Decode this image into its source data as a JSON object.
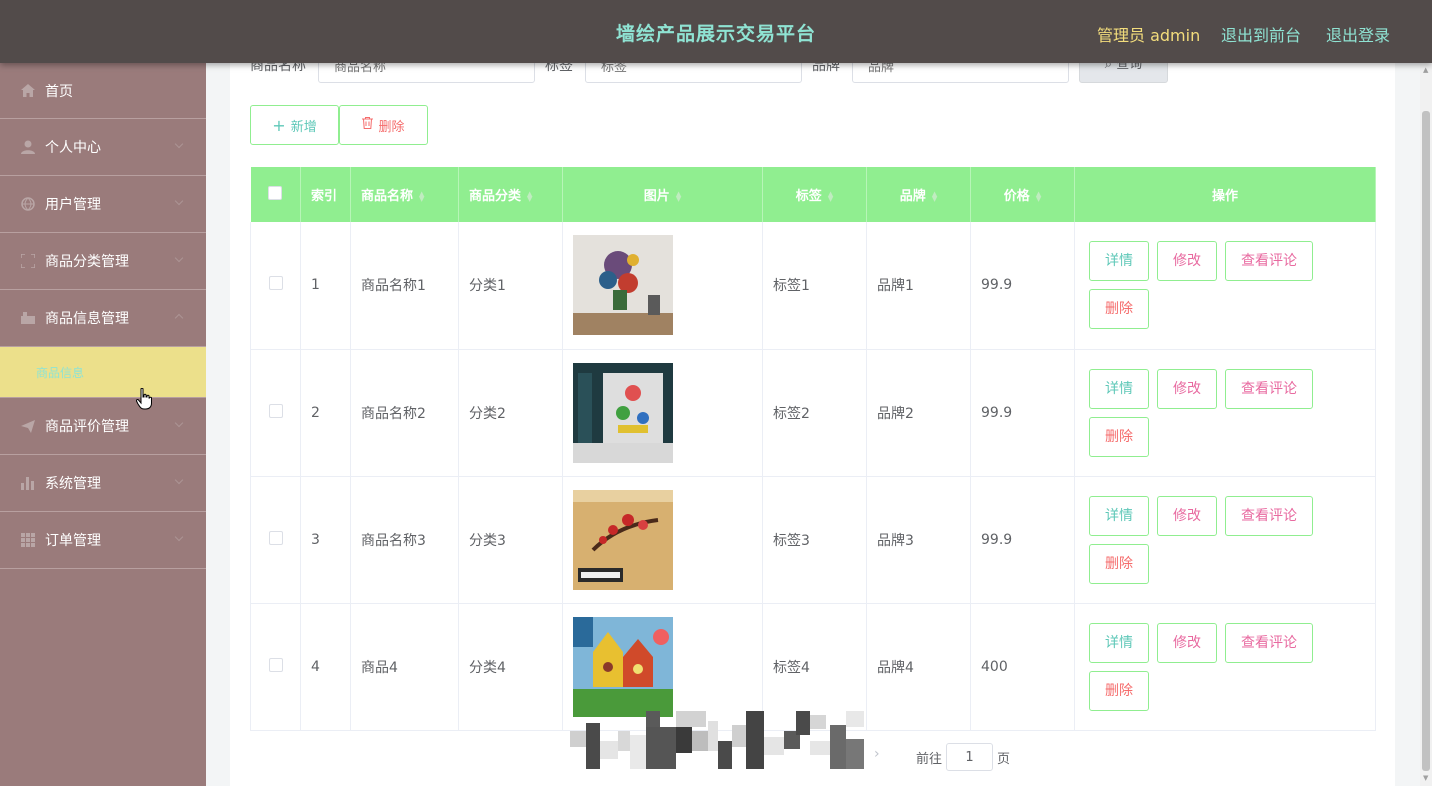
{
  "header": {
    "title": "墙绘产品展示交易平台",
    "admin_label": "管理员 admin",
    "front_link": "退出到前台",
    "logout_link": "退出登录"
  },
  "sidebar": {
    "items": [
      {
        "label": "首页",
        "icon": "home-icon"
      },
      {
        "label": "个人中心",
        "icon": "user-icon"
      },
      {
        "label": "用户管理",
        "icon": "globe-icon"
      },
      {
        "label": "商品分类管理",
        "icon": "frame-icon"
      },
      {
        "label": "商品信息管理",
        "icon": "shop-icon"
      },
      {
        "label": "商品评价管理",
        "icon": "send-icon"
      },
      {
        "label": "系统管理",
        "icon": "chart-icon"
      },
      {
        "label": "订单管理",
        "icon": "grid-icon"
      }
    ],
    "submenu_active": "商品信息"
  },
  "search": {
    "name_label": "商品名称",
    "name_placeholder": "商品名称",
    "tag_label": "标签",
    "tag_placeholder": "标签",
    "brand_label": "品牌",
    "brand_placeholder": "品牌",
    "query_button": "查询"
  },
  "toolbar": {
    "add_label": "新增",
    "delete_label": "删除"
  },
  "table": {
    "columns": [
      "索引",
      "商品名称",
      "商品分类",
      "图片",
      "标签",
      "品牌",
      "价格",
      "操作"
    ],
    "rows": [
      {
        "index": "1",
        "name": "商品名称1",
        "category": "分类1",
        "tag": "标签1",
        "brand": "品牌1",
        "price": "99.9"
      },
      {
        "index": "2",
        "name": "商品名称2",
        "category": "分类2",
        "tag": "标签2",
        "brand": "品牌2",
        "price": "99.9"
      },
      {
        "index": "3",
        "name": "商品名称3",
        "category": "分类3",
        "tag": "标签3",
        "brand": "品牌3",
        "price": "99.9"
      },
      {
        "index": "4",
        "name": "商品4",
        "category": "分类4",
        "tag": "标签4",
        "brand": "品牌4",
        "price": "400"
      }
    ],
    "actions": {
      "detail": "详情",
      "edit": "修改",
      "comment": "查看评论",
      "delete": "删除"
    }
  },
  "pagination": {
    "goto_label": "前往",
    "page_value": "1",
    "page_suffix": "页"
  },
  "colors": {
    "header_bg": "#524b4a",
    "title_color": "#8fe3d3",
    "sidebar_bg": "#9a7b7b",
    "submenu_bg": "#ece08b",
    "table_header_bg": "#90ee90"
  }
}
